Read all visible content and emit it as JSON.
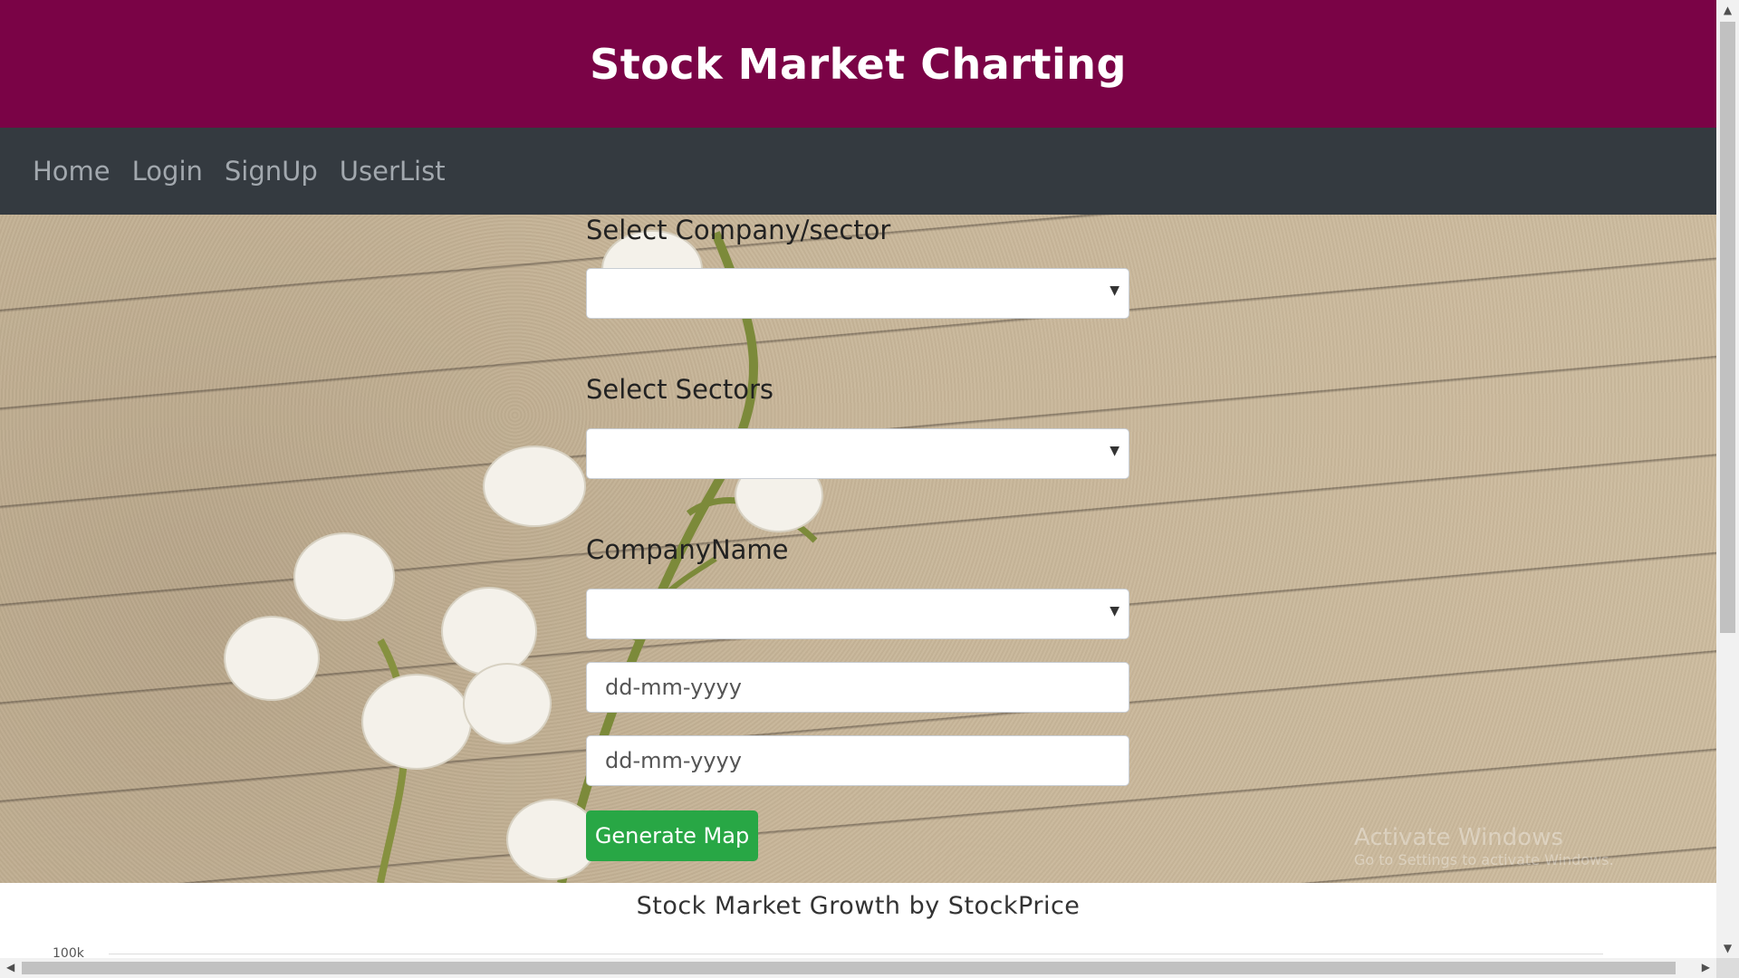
{
  "header": {
    "title": "Stock Market Charting"
  },
  "nav": {
    "items": [
      "Home",
      "Login",
      "SignUp",
      "UserList"
    ]
  },
  "form": {
    "company_sector_label": "Select Company/sector",
    "sectors_label": "Select Sectors",
    "company_name_label": "CompanyName",
    "from_date_placeholder": "dd-mm-yyyy",
    "to_date_placeholder": "dd-mm-yyyy",
    "generate_button": "Generate Map"
  },
  "chart": {
    "title": "Stock Market Growth by StockPrice",
    "first_tick": "100k"
  },
  "watermark": {
    "line1": "Activate Windows",
    "line2": "Go to Settings to activate Windows."
  },
  "colors": {
    "header": "#7a0346",
    "nav": "#343a40",
    "button": "#28a745"
  }
}
